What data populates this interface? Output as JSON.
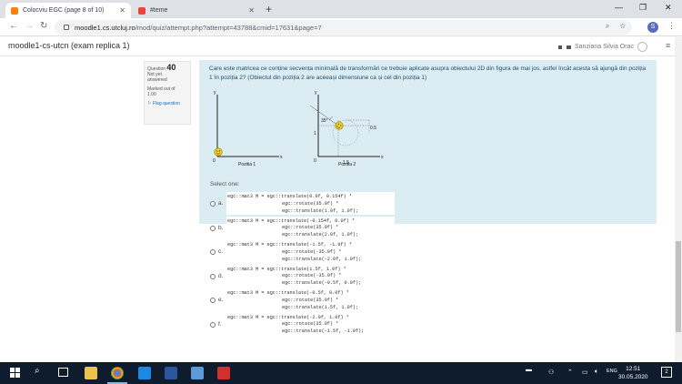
{
  "browser": {
    "tabs": [
      {
        "title": "Colocviu EGC (page 8 of 10)",
        "active": true
      },
      {
        "title": "#teme",
        "active": false
      }
    ],
    "new_tab": "+",
    "url_host": "moodle1.cs.utcluj.ro",
    "url_path": "/mod/quiz/attempt.php?attempt=43788&cmid=17631&page=7",
    "profile_initial": "S",
    "win_min": "—",
    "win_max": "❐",
    "win_close": "✕"
  },
  "moodle": {
    "course_title": "moodle1-cs-utcn (exam replica 1)",
    "user_name": "Sanziana Silvia Orac"
  },
  "question": {
    "label": "Question",
    "number": "40",
    "status_line1": "Not yet",
    "status_line2": "answered",
    "marked_line1": "Marked out of",
    "marked_line2": "1.00",
    "flag": "Flag question",
    "text": "Care este matricea ce conține secvența minimală de transformări ce trebuie aplicate asupra obiectului 2D din figura de mai jos, astfel încât acesta să ajungă din poziția 1 în poziția 2? (Obiectul din poziția 2 are aceeași dimensiune ca și cel din poziția 1)",
    "figure": {
      "pos1": {
        "y_axis": "y",
        "x_axis": "x",
        "origin": "0",
        "caption": "Pozitia 1"
      },
      "pos2": {
        "y_axis": "y",
        "x_axis": "x",
        "origin": "0",
        "caption": "Pozitia 2",
        "angle": "35°",
        "offset": "0.5",
        "y_tick": "1",
        "x_tick": "1.5"
      }
    },
    "select_one": "Select one:",
    "options": [
      {
        "letter": "a.",
        "lines": [
          "egc::mat3 M = egc::translate(0.0f, 0.154f) *",
          "egc::rotate(35.0f) *",
          "egc::translate(1.0f, 1.0f);"
        ]
      },
      {
        "letter": "b.",
        "lines": [
          "egc::mat3 M = egc::translate(-0.154f, 0.0f) *",
          "egc::rotate(35.0f) *",
          "egc::translate(2.0f, 1.0f);"
        ]
      },
      {
        "letter": "c.",
        "lines": [
          "egc::mat3 M = egc::translate(-1.5f, -1.0f) *",
          "egc::rotate(-35.0f) *",
          "egc::translate(-2.0f, 1.0f);"
        ]
      },
      {
        "letter": "d.",
        "lines": [
          "egc::mat3 M = egc::translate(1.5f, 1.0f) *",
          "egc::rotate(-35.0f) *",
          "egc::translate(-0.5f, 0.0f);"
        ]
      },
      {
        "letter": "e.",
        "lines": [
          "egc::mat3 M = egc::translate(-0.5f, 0.0f) *",
          "egc::rotate(35.0f) *",
          "egc::translate(1.5f, 1.0f);"
        ]
      },
      {
        "letter": "f.",
        "lines": [
          "egc::mat3 M = egc::translate(-2.0f, 1.0f) *",
          "egc::rotate(35.0f) *",
          "egc::translate(-1.5f, -1.0f);"
        ]
      }
    ]
  },
  "taskbar": {
    "time": "12:51",
    "date": "30.05.2020",
    "lang": "ENG",
    "notif_count": "2"
  }
}
